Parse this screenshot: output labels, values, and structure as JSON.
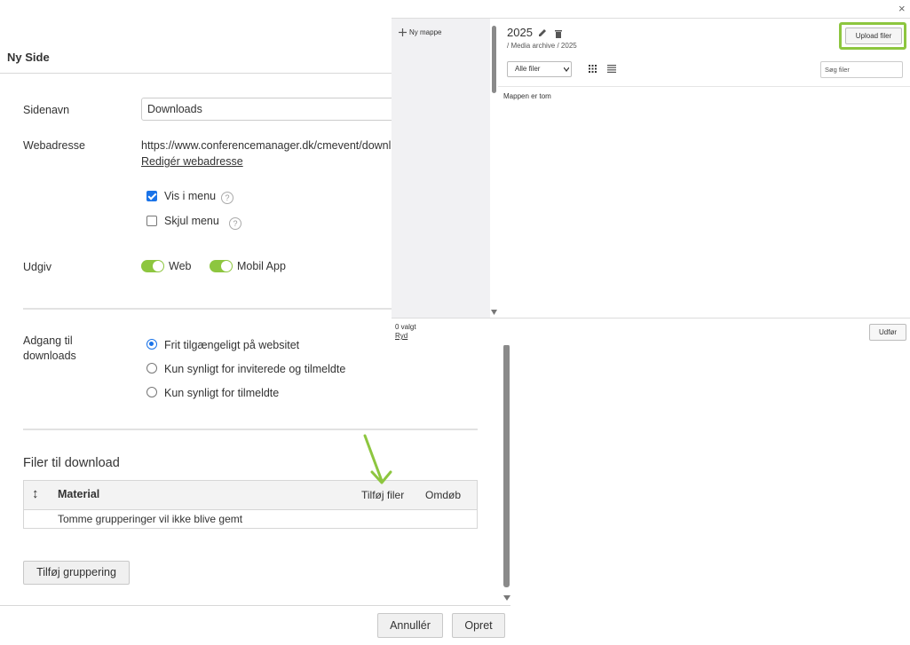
{
  "dialog": {
    "title": "Ny Side",
    "fields": {
      "sidenavn_label": "Sidenavn",
      "sidenavn_value": "Downloads",
      "webadresse_label": "Webadresse",
      "webadresse_value": "https://www.conferencemanager.dk/cmevent/downl",
      "edit_url_link": "Redigér webadresse",
      "show_in_menu": {
        "label": "Vis i menu",
        "checked": true
      },
      "hide_menu": {
        "label": "Skjul menu",
        "checked": false
      },
      "help_glyph": "?",
      "publish_label": "Udgiv",
      "publish_web": {
        "label": "Web",
        "on": true
      },
      "publish_app": {
        "label": "Mobil App",
        "on": true
      }
    },
    "access": {
      "label_line1": "Adgang til",
      "label_line2": "downloads",
      "options": [
        {
          "label": "Frit tilgængeligt på websitet",
          "selected": true
        },
        {
          "label": "Kun synligt for inviterede og tilmeldte",
          "selected": false
        },
        {
          "label": "Kun synligt for tilmeldte",
          "selected": false
        }
      ]
    },
    "files": {
      "heading": "Filer til download",
      "sort_glyph": "↕",
      "columns": {
        "material": "Material",
        "add_files": "Tilføj filer",
        "rename": "Omdøb"
      },
      "empty_row": "Tomme grupperinger vil ikke blive gemt",
      "add_group_button": "Tilføj gruppering"
    },
    "footer": {
      "cancel": "Annullér",
      "create": "Opret"
    }
  },
  "media_panel": {
    "close_glyph": "×",
    "new_folder": "Ny mappe",
    "new_folder_icon": "plus-icon",
    "folder_title": "2025",
    "breadcrumb": "/ Media archive / 2025",
    "upload_button": "Upload filer",
    "filter_select": "Alle filer",
    "search_placeholder": "Søg filer",
    "empty_message": "Mappen er tom",
    "selected_count": "0 valgt",
    "clear_link": "Ryd",
    "execute_button": "Udfør"
  },
  "colors": {
    "accent_green": "#8dc63f",
    "checkbox_blue": "#1a73e8",
    "sidebar_bg": "#f1f1f3"
  }
}
